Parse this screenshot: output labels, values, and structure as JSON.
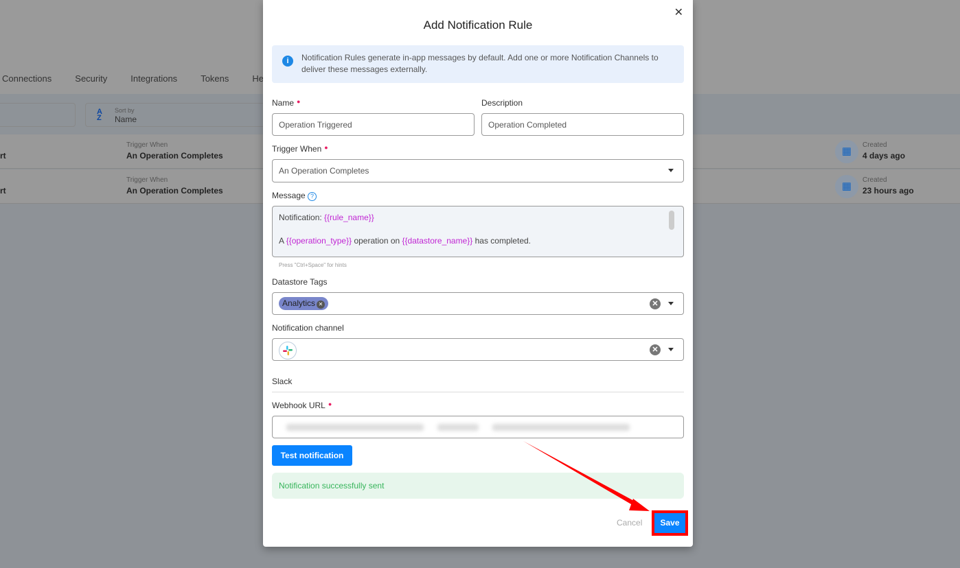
{
  "background": {
    "tabs": [
      "Connections",
      "Security",
      "Integrations",
      "Tokens",
      "Hea"
    ],
    "sort": {
      "label": "Sort by",
      "value": "Name"
    },
    "rows": [
      {
        "name": "rt",
        "trigger_label": "Trigger When",
        "trigger": "An Operation Completes",
        "created_label": "Created",
        "created": "4 days ago"
      },
      {
        "name": "rt",
        "trigger_label": "Trigger When",
        "trigger": "An Operation Completes",
        "created_label": "Created",
        "created": "23 hours ago"
      }
    ]
  },
  "modal": {
    "title": "Add Notification Rule",
    "info": "Notification Rules generate in-app messages by default. Add one or more Notification Channels to deliver these messages externally.",
    "name_label": "Name",
    "name_value": "Operation Triggered",
    "description_label": "Description",
    "description_value": "Operation Completed",
    "trigger_label": "Trigger When",
    "trigger_value": "An Operation Completes",
    "message_label": "Message",
    "message": {
      "l1_prefix": "Notification: ",
      "l1_var": "{{rule_name}}",
      "l2_a": "A ",
      "l2_var1": "{{operation_type}}",
      "l2_b": " operation on ",
      "l2_var2": "{{datastore_name}}",
      "l2_c": " has completed."
    },
    "hint": "Press \"Ctrl+Space\" for hints",
    "tags_label": "Datastore Tags",
    "tags": [
      "Analytics"
    ],
    "channel_label": "Notification channel",
    "channel_icon": "slack-icon",
    "section": "Slack",
    "webhook_label": "Webhook URL",
    "test_button": "Test notification",
    "success": "Notification successfully sent",
    "cancel": "Cancel",
    "save": "Save",
    "colors": {
      "primary": "#0a84ff",
      "annotation": "#ff0000",
      "success": "#37b55b",
      "variable": "#c026d3"
    }
  }
}
